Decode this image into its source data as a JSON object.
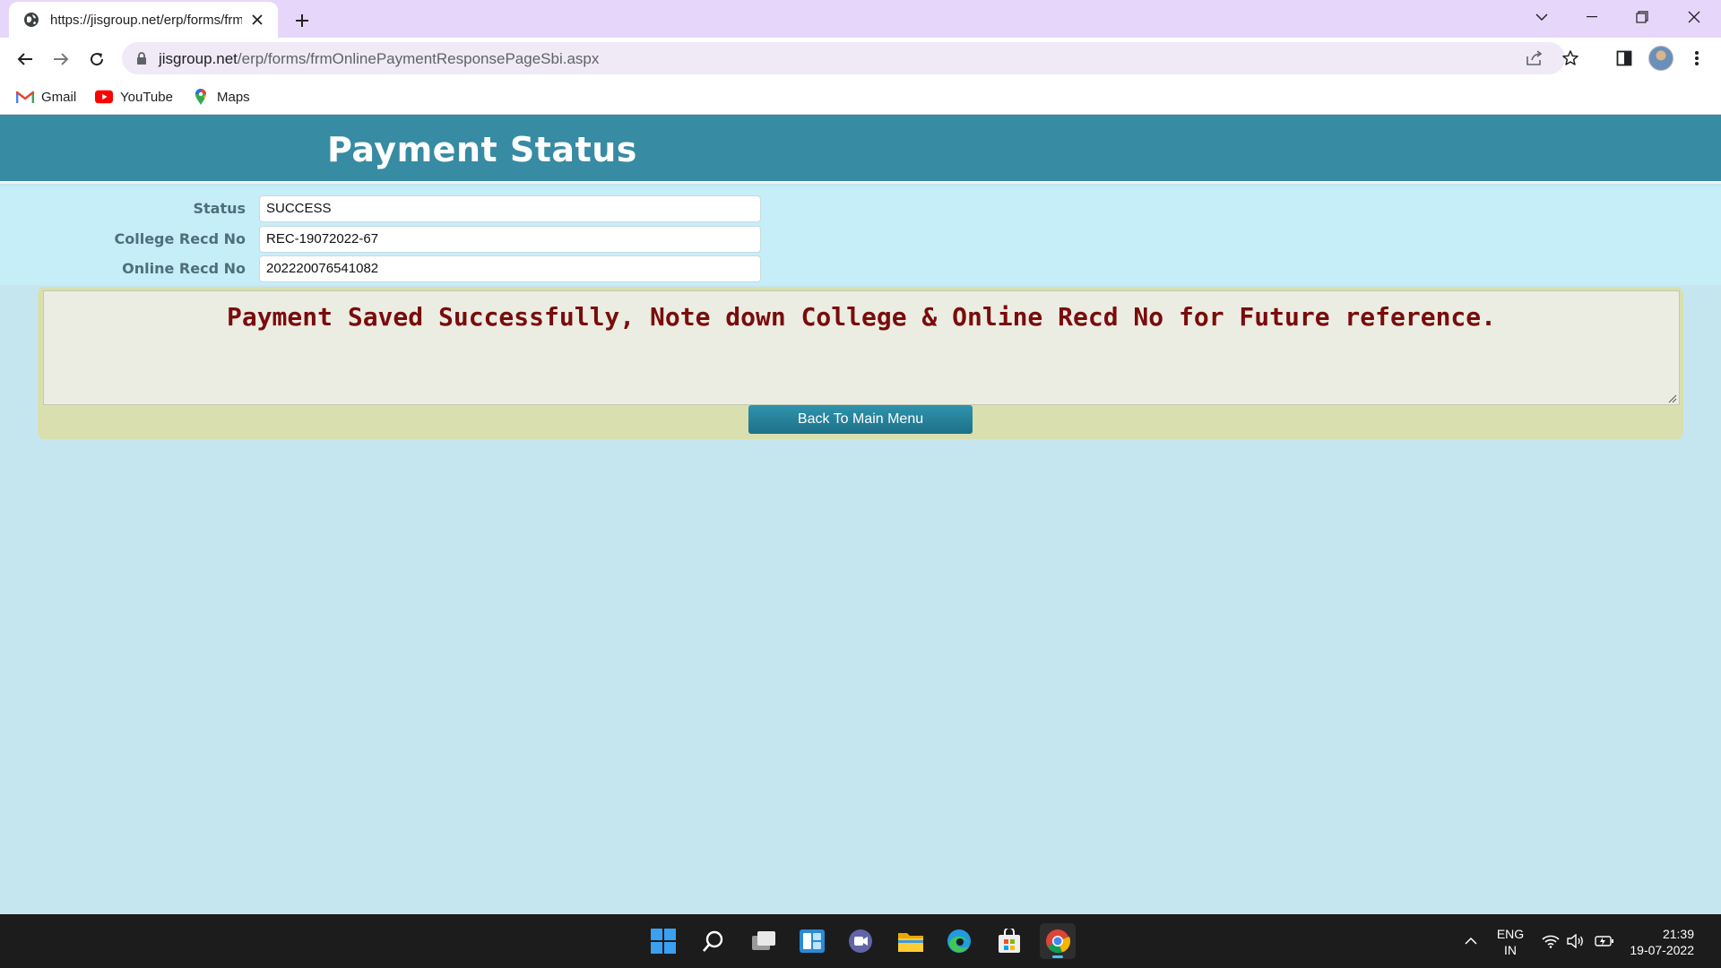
{
  "browser": {
    "tab_title": "https://jisgroup.net/erp/forms/frmOnlinePaymentResponsePageSbi.aspx",
    "url_host": "jisgroup.net",
    "url_path": "/erp/forms/frmOnlinePaymentResponsePageSbi.aspx",
    "bookmarks": [
      {
        "label": "Gmail",
        "icon": "gmail-icon"
      },
      {
        "label": "YouTube",
        "icon": "youtube-icon"
      },
      {
        "label": "Maps",
        "icon": "maps-icon"
      }
    ]
  },
  "page": {
    "title": "Payment Status",
    "fields": [
      {
        "label": "Status",
        "value": "SUCCESS"
      },
      {
        "label": "College Recd No",
        "value": "REC-19072022-67"
      },
      {
        "label": "Online Recd No",
        "value": "202220076541082"
      }
    ],
    "message": "Payment Saved Successfully, Note down College & Online Recd No for Future reference.",
    "back_button": "Back To Main Menu"
  },
  "taskbar": {
    "lang_line1": "ENG",
    "lang_line2": "IN",
    "time": "21:39",
    "date": "19-07-2022"
  },
  "colors": {
    "header": "#378ba3",
    "form_band": "#c6eef9",
    "panel": "#d9dfae",
    "message_text": "#7a0c0c",
    "button": "#1d7189",
    "browser_frame": "#e6d7fa"
  }
}
